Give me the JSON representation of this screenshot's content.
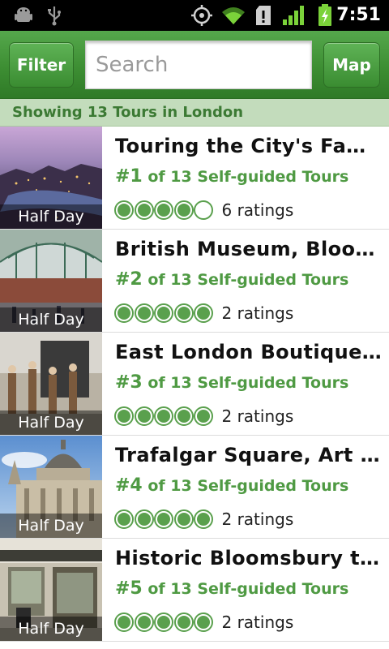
{
  "status_bar": {
    "time": "7:51",
    "icons": [
      "android-debug-icon",
      "usb-icon",
      "gps-icon",
      "wifi-icon",
      "sd-card-alert-icon",
      "signal-icon",
      "battery-charging-icon"
    ]
  },
  "toolbar": {
    "filter_label": "Filter",
    "search_placeholder": "Search",
    "map_label": "Map"
  },
  "summary": "Showing 13 Tours in London",
  "tours": [
    {
      "title": "Touring the City's Fam...",
      "rank": "#1",
      "rank_suffix": " of 13 Self-guided Tours",
      "rating": 4,
      "ratings_text": "6 ratings",
      "duration": "Half Day",
      "image": "city-night-skyline"
    },
    {
      "title": "British Museum, Bloom...",
      "rank": "#2",
      "rank_suffix": " of 13 Self-guided Tours",
      "rating": 5,
      "ratings_text": "2 ratings",
      "duration": "Half Day",
      "image": "covent-garden-market"
    },
    {
      "title": "East London Boutiques,...",
      "rank": "#3",
      "rank_suffix": " of 13 Self-guided Tours",
      "rating": 5,
      "ratings_text": "2 ratings",
      "duration": "Half Day",
      "image": "street-musicians"
    },
    {
      "title": "Trafalgar Square, Art ...",
      "rank": "#4",
      "rank_suffix": " of 13 Self-guided Tours",
      "rating": 5,
      "ratings_text": "2 ratings",
      "duration": "Half Day",
      "image": "st-pauls-dome"
    },
    {
      "title": "Historic Bloomsbury to ...",
      "rank": "#5",
      "rank_suffix": " of 13 Self-guided Tours",
      "rating": 5,
      "ratings_text": "2 ratings",
      "duration": "Half Day",
      "image": "pub-storefront"
    }
  ],
  "colors": {
    "brand_green": "#3d8e33",
    "rank_green": "#4f9a43",
    "summary_bar": "#c3dcbc"
  }
}
